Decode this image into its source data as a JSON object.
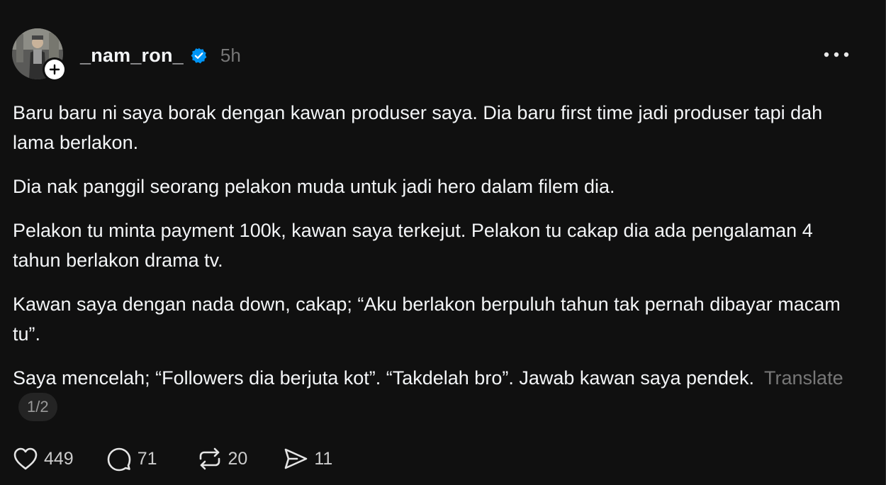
{
  "post": {
    "username": "_nam_ron_",
    "time": "5h",
    "paragraphs": [
      "Baru baru ni saya borak dengan kawan produser saya. Dia baru first time jadi produser tapi dah lama berlakon.",
      "Dia nak panggil seorang pelakon muda untuk jadi hero dalam filem dia.",
      "Pelakon tu minta payment 100k, kawan saya terkejut. Pelakon tu cakap dia ada pengalaman 4 tahun berlakon drama tv.",
      "Kawan saya dengan nada down, cakap; “Aku berlakon berpuluh tahun tak pernah dibayar macam tu”."
    ],
    "last_paragraph": "Saya mencelah; “Followers dia berjuta kot”. “Takdelah bro”. Jawab kawan saya pendek.",
    "translate_label": "Translate",
    "pager": "1/2"
  },
  "actions": {
    "likes": "449",
    "replies": "71",
    "reposts": "20",
    "shares": "11"
  },
  "icons": {
    "verified": "verified-badge-icon",
    "follow": "plus-icon",
    "more": "more-horizontal-icon",
    "like": "heart-icon",
    "reply": "comment-icon",
    "repost": "repost-icon",
    "share": "send-icon"
  },
  "colors": {
    "background": "#101010",
    "text": "#f3f5f7",
    "muted": "#777777",
    "verified": "#0095f6"
  }
}
